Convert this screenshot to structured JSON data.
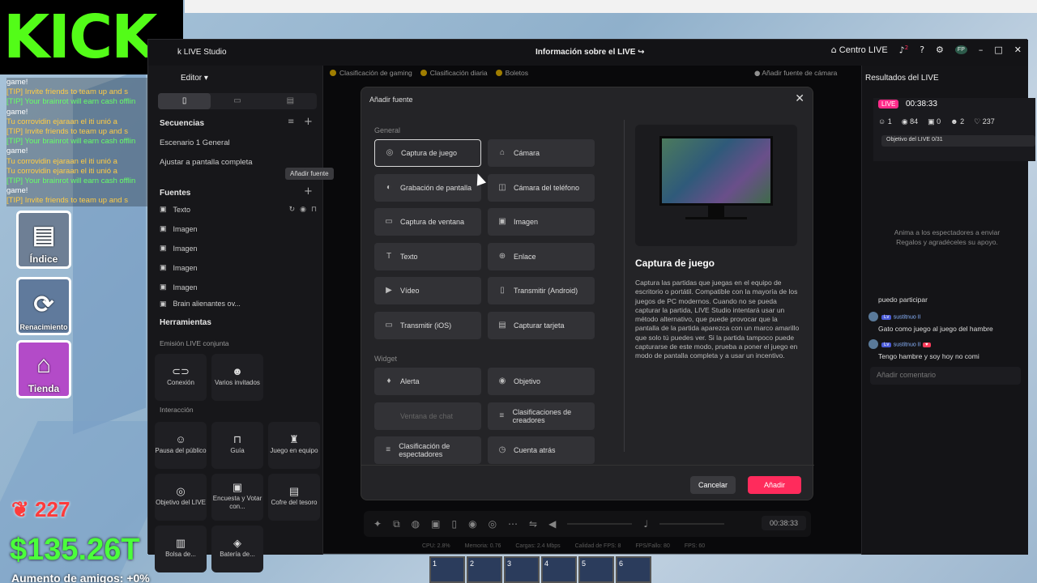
{
  "game": {
    "logo": "KICK",
    "chat": [
      {
        "text": "game!",
        "color": "#ffffff"
      },
      {
        "text": "[TIP] Invite friends to team up and s",
        "color": "#ffcc44"
      },
      {
        "text": "[TIP] Your brainrot will earn cash offlin",
        "color": "#66ff66"
      },
      {
        "text": "game!",
        "color": "#ffffff"
      },
      {
        "text": "Tu corrovidin ejaraan el iti unió a",
        "color": "#ffcc44"
      },
      {
        "text": "[TIP] Invite friends to team up and s",
        "color": "#ffcc44"
      },
      {
        "text": "[TIP] Your brainrot will earn cash offlin",
        "color": "#66ff66"
      },
      {
        "text": "game!",
        "color": "#ffffff"
      },
      {
        "text": "Tu corrovidin ejaraan el iti unió a",
        "color": "#ffcc44"
      },
      {
        "text": "Tu corrovidin ejaraan el iti unió a",
        "color": "#ffcc44"
      },
      {
        "text": "[TIP] Your brainrot will earn cash offlin",
        "color": "#66ff66"
      },
      {
        "text": "game!",
        "color": "#ffffff"
      },
      {
        "text": "[TIP] Invite friends to team up and s",
        "color": "#ffcc44"
      }
    ],
    "buttons": [
      "Índice",
      "Renacimiento",
      "Tienda"
    ],
    "coins": "227",
    "money": "$135.26T",
    "friends": "Aumento de amigos: +0%",
    "hotbar": [
      "1",
      "2",
      "3",
      "4",
      "5",
      "6"
    ]
  },
  "app": {
    "title": "k LIVE Studio",
    "center_title": "Información sobre el LIVE",
    "center_label": "Centro LIVE",
    "avatar": "FP",
    "notif_count": "2"
  },
  "left": {
    "editor": "Editor",
    "scenes_head": "Secuencias",
    "scene1": "Escenario 1 General",
    "scene2": "Ajustar a pantalla completa",
    "sources_head": "Fuentes",
    "sources": [
      "Texto",
      "Imagen",
      "Imagen",
      "Imagen",
      "Imagen",
      "Brain alienantes ov..."
    ],
    "tools_head": "Herramientas",
    "tools_sub1": "Emisión LIVE conjunta",
    "tools1": [
      "Conexión",
      "Varios invitados"
    ],
    "tools_sub2": "Interacción",
    "tools2": [
      "Pausa del público",
      "Guía",
      "Juego en equipo",
      "Objetivo del LIVE",
      "Encuesta y Votar con...",
      "Cofre del tesoro",
      "Bolsa de...",
      "Batería de..."
    ]
  },
  "center": {
    "tags": [
      "Clasificación de gaming",
      "Clasificación diaria",
      "Boletos"
    ],
    "add_camera": "Añadir fuente de cámara",
    "timer": "00:38:33",
    "status": [
      "CPU: 2.8%",
      "Memoria: 0.76",
      "Cargas: 2.4 Mbps",
      "Calidad de FPS: 8",
      "FPS/Fallo: 80",
      "FPS: 60"
    ]
  },
  "right": {
    "title": "Resultados del LIVE",
    "live_badge": "LIVE",
    "live_time": "00:38:33",
    "stats": [
      "1",
      "84",
      "0",
      "2",
      "237"
    ],
    "goal": "Objetivo del LIVE 0/31",
    "empty_msg": "Anima a los espectadores a enviar Regalos y agradéceles su apoyo.",
    "comments": [
      {
        "user": "",
        "text": "puedo participar"
      },
      {
        "user": "sustitnuo II",
        "text": "Gato como juego al juego del hambre"
      },
      {
        "user": "sustitnuo II",
        "text": "Tengo hambre y soy hoy no comi"
      }
    ],
    "comment_placeholder": "Añadir comentario"
  },
  "modal": {
    "title": "Añadir fuente",
    "section_general": "General",
    "section_widget": "Widget",
    "general": [
      {
        "label": "Captura de juego",
        "icon": "◎",
        "sel": true
      },
      {
        "label": "Cámara",
        "icon": "⌂"
      },
      {
        "label": "Grabación de pantalla",
        "icon": "◐"
      },
      {
        "label": "Cámara del teléfono",
        "icon": "◫"
      },
      {
        "label": "Captura de ventana",
        "icon": "▭"
      },
      {
        "label": "Imagen",
        "icon": "▣"
      },
      {
        "label": "Texto",
        "icon": "T"
      },
      {
        "label": "Enlace",
        "icon": "⊕"
      },
      {
        "label": "Vídeo",
        "icon": "▶"
      },
      {
        "label": "Transmitir (Android)",
        "icon": "▯"
      },
      {
        "label": "Transmitir (iOS)",
        "icon": "▭"
      },
      {
        "label": "Capturar tarjeta",
        "icon": "▤"
      }
    ],
    "widgets": [
      {
        "label": "Alerta",
        "icon": "♦"
      },
      {
        "label": "Objetivo",
        "icon": "◉"
      },
      {
        "label": "Ventana de chat",
        "icon": "",
        "dis": true
      },
      {
        "label": "Clasificaciones de creadores",
        "icon": "≡"
      },
      {
        "label": "Clasificación de espectadores",
        "icon": "≡"
      },
      {
        "label": "Cuenta atrás",
        "icon": "◷"
      }
    ],
    "desc_title": "Captura de juego",
    "desc_body": "Captura las partidas que juegas en el equipo de escritorio o portátil. Compatible con la mayoría de los juegos de PC modernos. Cuando no se pueda capturar la partida, LIVE Studio intentará usar un método alternativo, que puede provocar que la pantalla de la partida aparezca con un marco amarillo que solo tú puedes ver. Si la partida tampoco puede capturarse de este modo, prueba a poner el juego en modo de pantalla completa y a usar un incentivo.",
    "cancel": "Cancelar",
    "add": "Añadir",
    "tooltip": "Añadir fuente"
  }
}
